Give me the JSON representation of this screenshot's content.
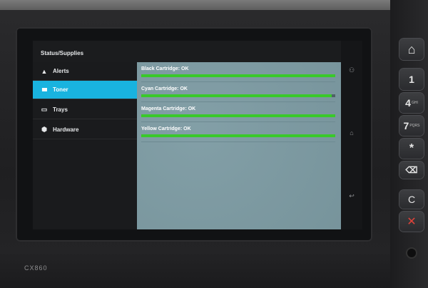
{
  "screen": {
    "title": "Status/Supplies"
  },
  "sidebar": {
    "items": [
      {
        "label": "Alerts",
        "icon": "warning-triangle-icon",
        "glyph": "▲",
        "active": false
      },
      {
        "label": "Toner",
        "icon": "toner-bars-icon",
        "glyph": "▮▮▮",
        "active": true
      },
      {
        "label": "Trays",
        "icon": "tray-icon",
        "glyph": "▭",
        "active": false
      },
      {
        "label": "Hardware",
        "icon": "hardware-gear-icon",
        "glyph": "⬢",
        "active": false
      }
    ]
  },
  "supplies": [
    {
      "label": "Black Cartridge: OK",
      "level": 1.0
    },
    {
      "label": "Cyan Cartridge: OK",
      "level": 0.98
    },
    {
      "label": "Magenta Cartridge: OK",
      "level": 1.0
    },
    {
      "label": "Yellow Cartridge: OK",
      "level": 1.0
    }
  ],
  "nav": [
    {
      "icon": "user-icon",
      "glyph": "⚇"
    },
    {
      "icon": "home-icon",
      "glyph": "⌂"
    },
    {
      "icon": "back-arrow-icon",
      "glyph": "↩"
    }
  ],
  "device": {
    "model": "CX860"
  },
  "keypad": {
    "home_glyph": "⌂",
    "k1": "1",
    "k4": "4",
    "k4_sub": "GHI",
    "k7": "7",
    "k7_sub": "PQRS",
    "star": "*",
    "backspace_glyph": "⌫",
    "reset_glyph": "C",
    "stop_glyph": "✕"
  },
  "colors": {
    "accent": "#19b3df",
    "bar_green": "#39c92a",
    "content_bg": "#7c9aa2",
    "stop_red": "#e0433a"
  }
}
